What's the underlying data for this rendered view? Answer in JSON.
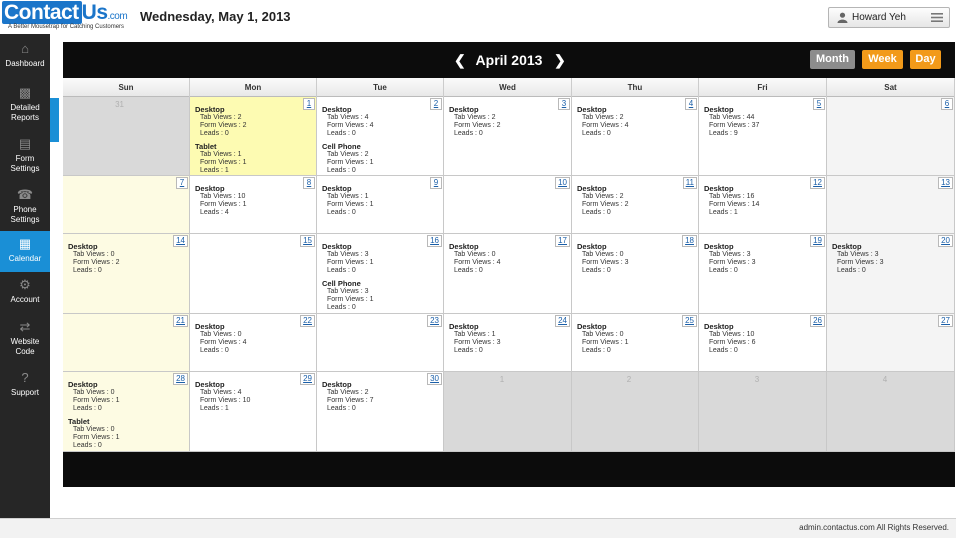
{
  "header": {
    "logo_part1": "Contact",
    "logo_part2": "Us",
    "logo_part3": ".com",
    "logo_tagline": "A Better Mousetrap for Catching Customers",
    "date": "Wednesday, May 1, 2013",
    "user_name": "Howard Yeh"
  },
  "sidebar": {
    "items": [
      {
        "label1": "Dashboard",
        "label2": "",
        "icon": "home-icon"
      },
      {
        "label1": "Detailed",
        "label2": "Reports",
        "icon": "bar-chart-icon"
      },
      {
        "label1": "Form",
        "label2": "Settings",
        "icon": "form-icon"
      },
      {
        "label1": "Phone",
        "label2": "Settings",
        "icon": "phone-icon"
      },
      {
        "label1": "Calendar",
        "label2": "",
        "icon": "calendar-icon"
      },
      {
        "label1": "Account",
        "label2": "",
        "icon": "gear-icon"
      },
      {
        "label1": "Website",
        "label2": "Code",
        "icon": "code-icon"
      },
      {
        "label1": "Support",
        "label2": "",
        "icon": "question-icon"
      }
    ],
    "active_index": 4
  },
  "calendar": {
    "month_title": "April 2013",
    "view_buttons": {
      "month": "Month",
      "week": "Week",
      "day": "Day"
    },
    "weekdays": [
      "Sun",
      "Mon",
      "Tue",
      "Wed",
      "Thu",
      "Fri",
      "Sat"
    ],
    "labels": {
      "tab_views": "Tab Views : ",
      "form_views": "Form Views : ",
      "leads": "Leads : "
    },
    "today_day": 1,
    "weeks": [
      [
        {
          "day": "31",
          "other": true,
          "entries": []
        },
        {
          "day": "1",
          "entries": [
            {
              "device": "Desktop",
              "tab": 2,
              "form": 2,
              "leads": 0
            },
            {
              "device": "Tablet",
              "tab": 1,
              "form": 1,
              "leads": 1
            }
          ]
        },
        {
          "day": "2",
          "entries": [
            {
              "device": "Desktop",
              "tab": 4,
              "form": 4,
              "leads": 0
            },
            {
              "device": "Cell Phone",
              "tab": 2,
              "form": 1,
              "leads": 0
            }
          ]
        },
        {
          "day": "3",
          "entries": [
            {
              "device": "Desktop",
              "tab": 2,
              "form": 2,
              "leads": 0
            }
          ]
        },
        {
          "day": "4",
          "entries": [
            {
              "device": "Desktop",
              "tab": 2,
              "form": 4,
              "leads": 0
            }
          ]
        },
        {
          "day": "5",
          "entries": [
            {
              "device": "Desktop",
              "tab": 44,
              "form": 37,
              "leads": 9
            }
          ]
        },
        {
          "day": "6",
          "entries": []
        }
      ],
      [
        {
          "day": "7",
          "entries": []
        },
        {
          "day": "8",
          "entries": [
            {
              "device": "Desktop",
              "tab": 10,
              "form": 1,
              "leads": 4
            }
          ]
        },
        {
          "day": "9",
          "entries": [
            {
              "device": "Desktop",
              "tab": 1,
              "form": 1,
              "leads": 0
            }
          ]
        },
        {
          "day": "10",
          "entries": []
        },
        {
          "day": "11",
          "entries": [
            {
              "device": "Desktop",
              "tab": 2,
              "form": 2,
              "leads": 0
            }
          ]
        },
        {
          "day": "12",
          "entries": [
            {
              "device": "Desktop",
              "tab": 16,
              "form": 14,
              "leads": 1
            }
          ]
        },
        {
          "day": "13",
          "entries": []
        }
      ],
      [
        {
          "day": "14",
          "entries": [
            {
              "device": "Desktop",
              "tab": 0,
              "form": 2,
              "leads": 0
            }
          ]
        },
        {
          "day": "15",
          "entries": []
        },
        {
          "day": "16",
          "entries": [
            {
              "device": "Desktop",
              "tab": 3,
              "form": 1,
              "leads": 0
            },
            {
              "device": "Cell Phone",
              "tab": 3,
              "form": 1,
              "leads": 0
            }
          ]
        },
        {
          "day": "17",
          "entries": [
            {
              "device": "Desktop",
              "tab": 0,
              "form": 4,
              "leads": 0
            }
          ]
        },
        {
          "day": "18",
          "entries": [
            {
              "device": "Desktop",
              "tab": 0,
              "form": 3,
              "leads": 0
            }
          ]
        },
        {
          "day": "19",
          "entries": [
            {
              "device": "Desktop",
              "tab": 3,
              "form": 3,
              "leads": 0
            }
          ]
        },
        {
          "day": "20",
          "entries": [
            {
              "device": "Desktop",
              "tab": 3,
              "form": 3,
              "leads": 0
            }
          ]
        }
      ],
      [
        {
          "day": "21",
          "entries": []
        },
        {
          "day": "22",
          "entries": [
            {
              "device": "Desktop",
              "tab": 0,
              "form": 4,
              "leads": 0
            }
          ]
        },
        {
          "day": "23",
          "entries": []
        },
        {
          "day": "24",
          "entries": [
            {
              "device": "Desktop",
              "tab": 1,
              "form": 3,
              "leads": 0
            }
          ]
        },
        {
          "day": "25",
          "entries": [
            {
              "device": "Desktop",
              "tab": 0,
              "form": 1,
              "leads": 0
            }
          ]
        },
        {
          "day": "26",
          "entries": [
            {
              "device": "Desktop",
              "tab": 10,
              "form": 6,
              "leads": 0
            }
          ]
        },
        {
          "day": "27",
          "entries": []
        }
      ],
      [
        {
          "day": "28",
          "entries": [
            {
              "device": "Desktop",
              "tab": 0,
              "form": 1,
              "leads": 0
            },
            {
              "device": "Tablet",
              "tab": 0,
              "form": 1,
              "leads": 0
            }
          ]
        },
        {
          "day": "29",
          "entries": [
            {
              "device": "Desktop",
              "tab": 4,
              "form": 10,
              "leads": 1
            }
          ]
        },
        {
          "day": "30",
          "entries": [
            {
              "device": "Desktop",
              "tab": 2,
              "form": 7,
              "leads": 0
            }
          ]
        },
        {
          "day": "1",
          "other": true,
          "entries": []
        },
        {
          "day": "2",
          "other": true,
          "entries": []
        },
        {
          "day": "3",
          "other": true,
          "entries": []
        },
        {
          "day": "4",
          "other": true,
          "entries": []
        }
      ]
    ]
  },
  "footer": {
    "text": "admin.contactus.com All Rights Reserved."
  },
  "colors": {
    "accent": "#1a8fd6",
    "orange": "#f29a1a",
    "today": "#fdfbb2",
    "sunday": "#fdfbe3"
  }
}
